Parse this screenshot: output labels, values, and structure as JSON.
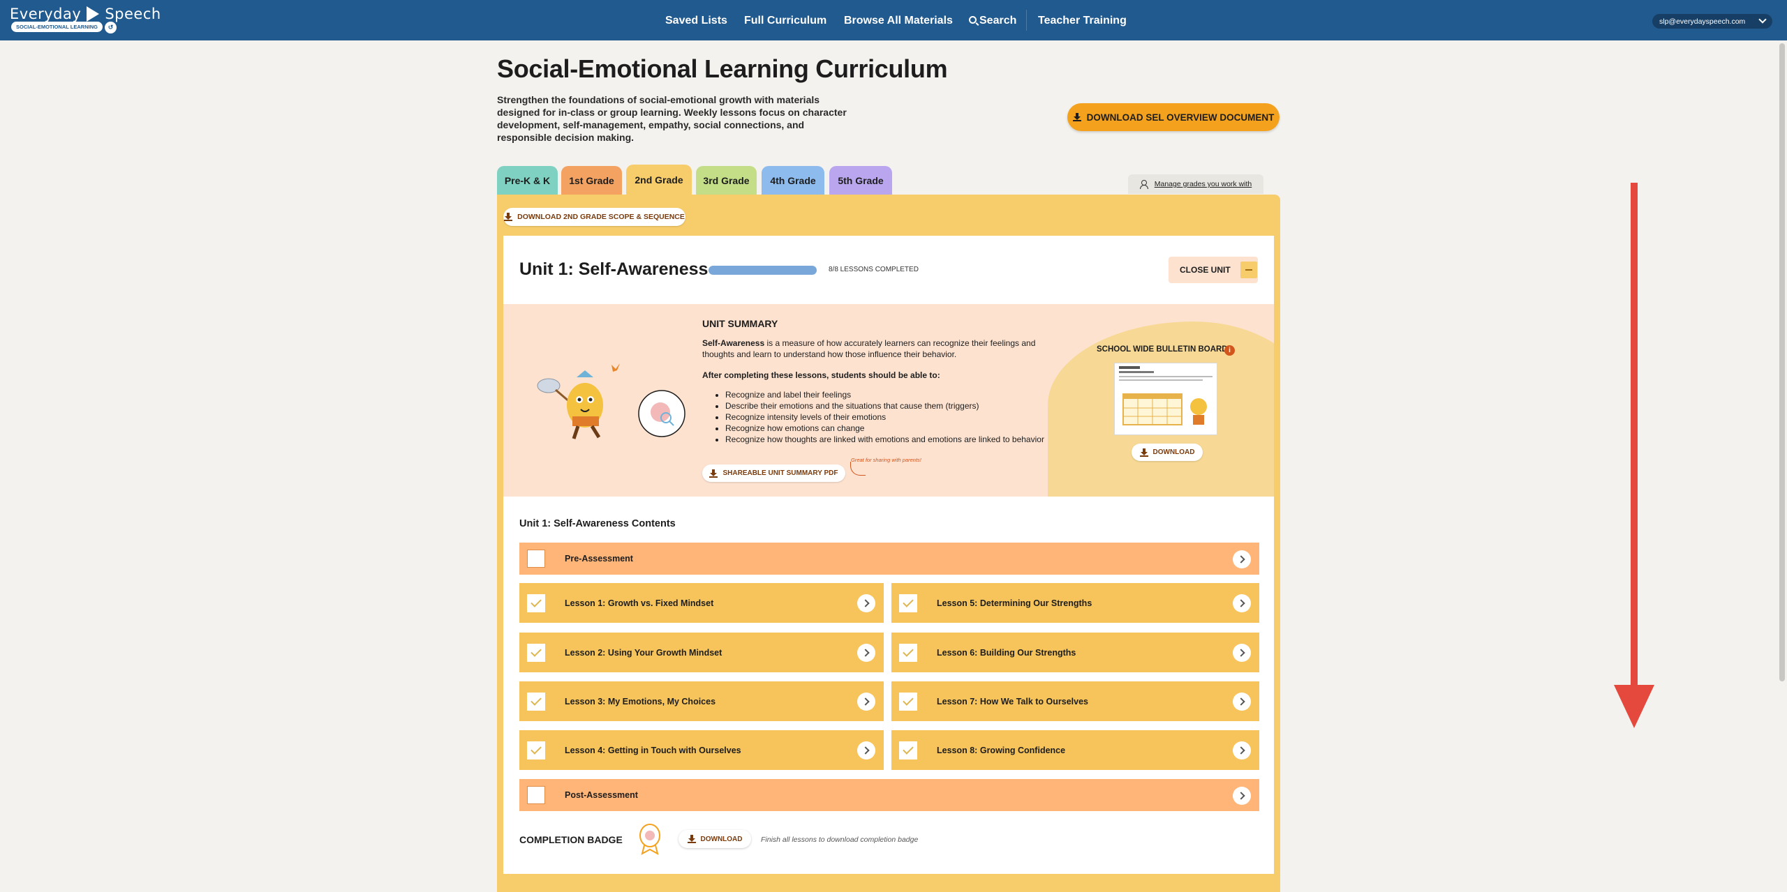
{
  "brand": {
    "name_part1": "Everyday",
    "name_part2": "Speech",
    "subtitle": "SOCIAL-EMOTIONAL LEARNING",
    "subtitle_badge": "↺"
  },
  "nav": {
    "items": [
      "Saved Lists",
      "Full Curriculum",
      "Browse All Materials",
      "Search",
      "Teacher Training"
    ],
    "user_email": "slp@everydayspeech.com"
  },
  "page": {
    "title": "Social-Emotional Learning Curriculum",
    "description": "Strengthen the foundations of social-emotional growth with materials designed for in-class or group learning. Weekly lessons focus on character development, self-management, empathy, social connections, and responsible decision making.",
    "download_overview": "DOWNLOAD SEL OVERVIEW DOCUMENT"
  },
  "tabs": [
    {
      "label": "Pre-K & K",
      "color": "#7fd1c1"
    },
    {
      "label": "1st Grade",
      "color": "#f4a261"
    },
    {
      "label": "2nd Grade",
      "color": "#f7cd6c",
      "active": true
    },
    {
      "label": "3rd Grade",
      "color": "#c3de87"
    },
    {
      "label": "4th Grade",
      "color": "#8dbbee"
    },
    {
      "label": "5th Grade",
      "color": "#b9a6ef"
    }
  ],
  "manage_grades": "Manage grades you work with",
  "scope_download": "DOWNLOAD 2ND GRADE SCOPE & SEQUENCE",
  "unit": {
    "title": "Unit 1: Self-Awareness",
    "progress_fraction": 1.0,
    "progress_label": "8/8 LESSONS COMPLETED",
    "close_label": "CLOSE UNIT",
    "summary_heading": "UNIT SUMMARY",
    "summary_term": "Self-Awareness",
    "summary_text": " is a measure of how accurately learners can recognize their feelings and thoughts and learn to understand how those influence their behavior.",
    "after_heading": "After completing these lessons, students should be able to:",
    "outcomes": [
      "Recognize and label their feelings",
      "Describe their emotions and the situations that cause them (triggers)",
      "Recognize intensity levels of their emotions",
      "Recognize how emotions can change",
      "Recognize how thoughts are linked with emotions and emotions are linked to behavior"
    ],
    "shareable_label": "SHAREABLE UNIT SUMMARY PDF",
    "shareable_note": "Great for sharing with parents!",
    "bulletin_title": "SCHOOL WIDE BULLETIN BOARD",
    "bulletin_info": "i",
    "bulletin_download": "DOWNLOAD",
    "contents_title": "Unit 1: Self-Awareness Contents",
    "pre_assessment": "Pre-Assessment",
    "post_assessment": "Post-Assessment",
    "lessons_left": [
      {
        "prefix": "Lesson 1:",
        "title": "Growth vs. Fixed Mindset"
      },
      {
        "prefix": "Lesson 2:",
        "title": "Using Your Growth Mindset"
      },
      {
        "prefix": "Lesson 3:",
        "title": "My Emotions, My Choices"
      },
      {
        "prefix": "Lesson 4:",
        "title": "Getting in Touch with Ourselves"
      }
    ],
    "lessons_right": [
      {
        "prefix": "Lesson 5:",
        "title": "Determining Our Strengths"
      },
      {
        "prefix": "Lesson 6:",
        "title": "Building Our Strengths"
      },
      {
        "prefix": "Lesson 7:",
        "title": "How We Talk to Ourselves"
      },
      {
        "prefix": "Lesson 8:",
        "title": "Growing Confidence"
      }
    ],
    "badge_label": "COMPLETION BADGE",
    "badge_download": "DOWNLOAD",
    "badge_note": "Finish all lessons to download completion badge"
  },
  "annotation": {
    "icon": "red-down-arrow",
    "color": "#e5483d"
  }
}
